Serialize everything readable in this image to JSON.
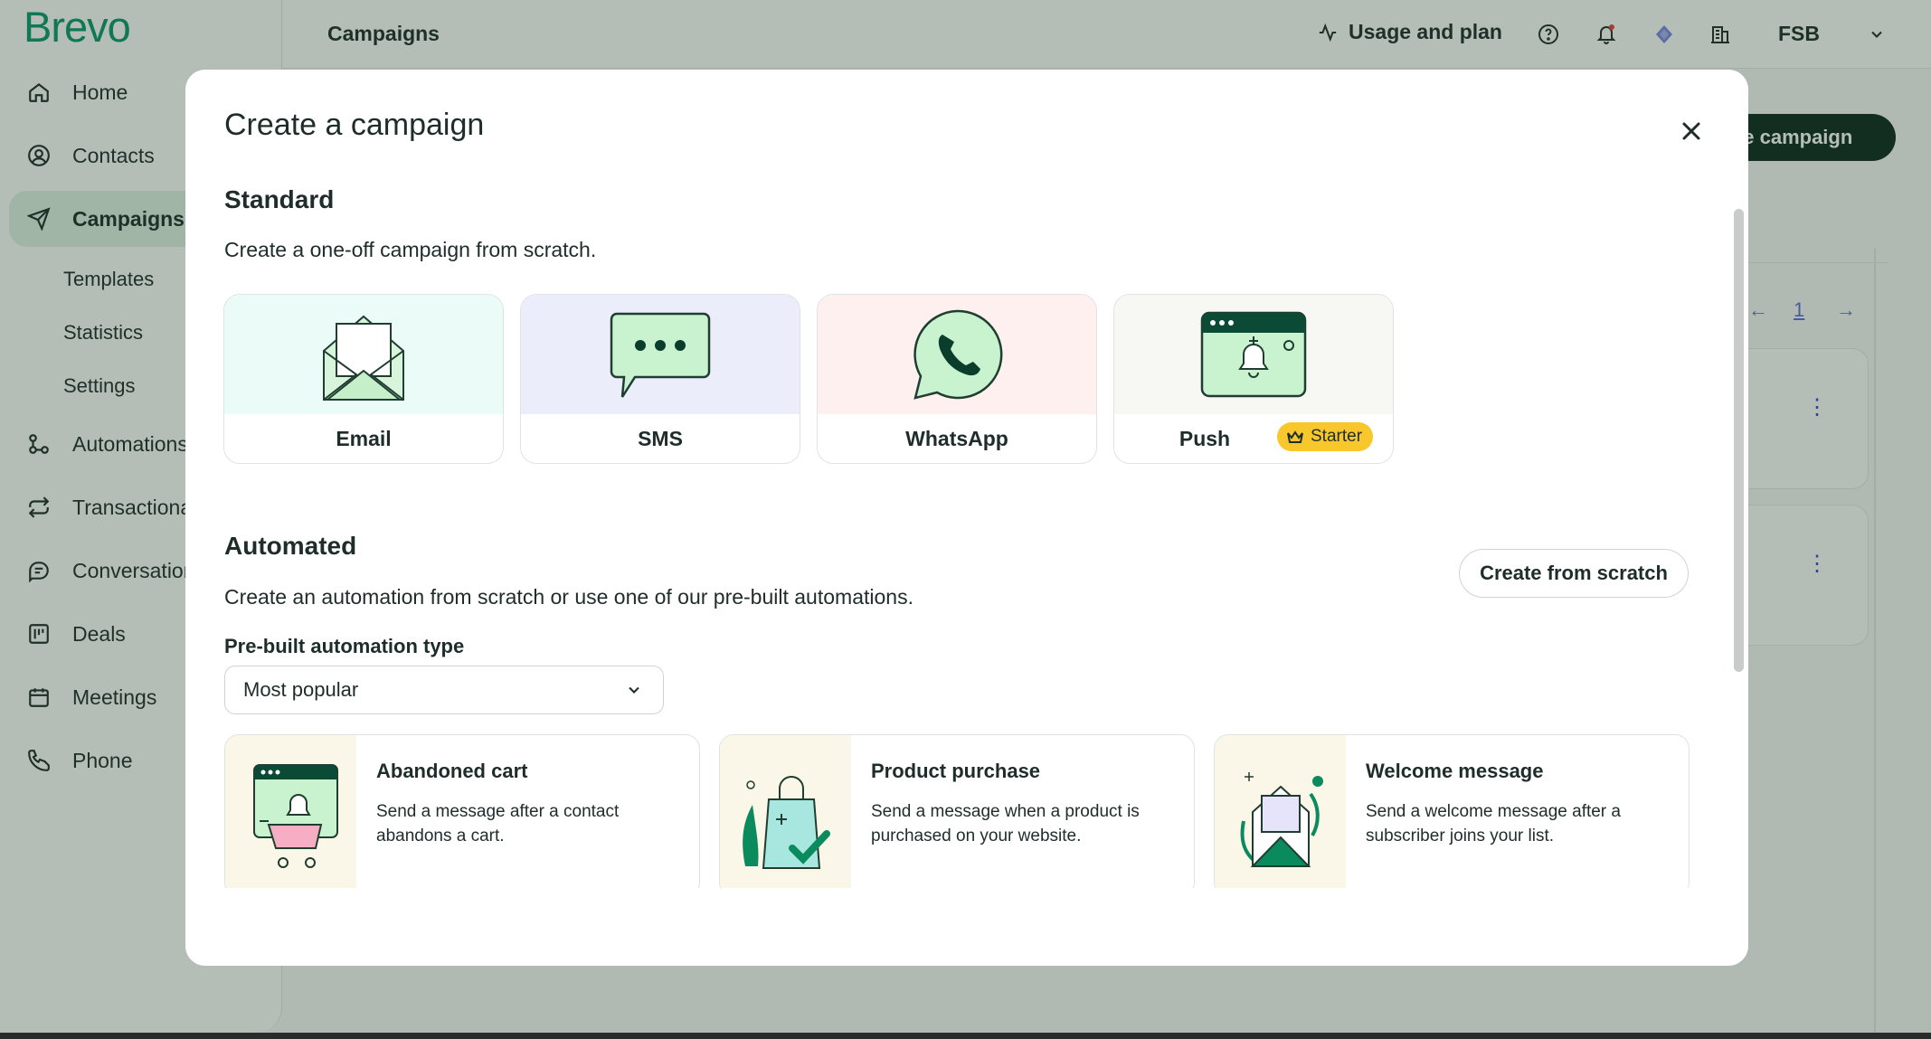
{
  "app": {
    "logo": "Brevo",
    "page_title": "Campaigns",
    "sidebar": {
      "items": [
        {
          "label": "Home",
          "icon": "home-icon"
        },
        {
          "label": "Contacts",
          "icon": "contacts-icon"
        },
        {
          "label": "Campaigns",
          "icon": "send-icon",
          "active": true
        },
        {
          "label": "Automations",
          "icon": "automations-icon"
        },
        {
          "label": "Transactional",
          "icon": "transactional-icon"
        },
        {
          "label": "Conversations",
          "icon": "conversations-icon"
        },
        {
          "label": "Deals",
          "icon": "deals-icon"
        },
        {
          "label": "Meetings",
          "icon": "calendar-icon"
        },
        {
          "label": "Phone",
          "icon": "phone-icon"
        }
      ],
      "subitems": [
        "Templates",
        "Statistics",
        "Settings"
      ]
    },
    "topbar": {
      "usage_label": "Usage and plan",
      "account": "FSB"
    },
    "background": {
      "create_button": "ate campaign",
      "pager_page": "1"
    }
  },
  "modal": {
    "title": "Create a campaign",
    "standard": {
      "title": "Standard",
      "description": "Create a one-off campaign from scratch.",
      "channels": [
        {
          "name": "Email",
          "bg": "#ebfbf8"
        },
        {
          "name": "SMS",
          "bg": "#ecedfb"
        },
        {
          "name": "WhatsApp",
          "bg": "#fdf0ef"
        },
        {
          "name": "Push",
          "bg": "#f7f7f4",
          "badge": "Starter"
        }
      ]
    },
    "automated": {
      "title": "Automated",
      "description": "Create an automation from scratch or use one of our pre-built automations.",
      "scratch_button": "Create from scratch",
      "type_label": "Pre-built automation type",
      "type_value": "Most popular",
      "cards": [
        {
          "title": "Abandoned cart",
          "description": "Send a message after a contact abandons a cart."
        },
        {
          "title": "Product purchase",
          "description": "Send a message when a product is purchased on your website."
        },
        {
          "title": "Welcome message",
          "description": "Send a welcome message after a subscriber joins your list."
        }
      ]
    }
  },
  "colors": {
    "brand_green": "#0b996e",
    "dark_green": "#0b4a35",
    "badge_yellow": "#f8c72c",
    "overlay": "rgba(31,56,36,0.33)"
  }
}
